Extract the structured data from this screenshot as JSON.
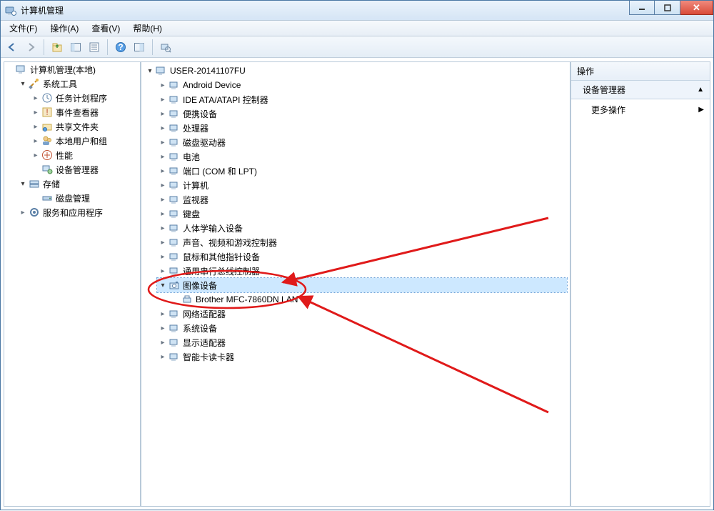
{
  "window": {
    "title": "计算机管理"
  },
  "menu": {
    "file": "文件(F)",
    "action": "操作(A)",
    "view": "查看(V)",
    "help": "帮助(H)"
  },
  "left_tree": {
    "root": "计算机管理(本地)",
    "system_tools": "系统工具",
    "task_scheduler": "任务计划程序",
    "event_viewer": "事件查看器",
    "shared_folders": "共享文件夹",
    "local_users": "本地用户和组",
    "performance": "性能",
    "device_manager": "设备管理器",
    "storage": "存储",
    "disk_mgmt": "磁盘管理",
    "services": "服务和应用程序"
  },
  "mid_tree": {
    "root": "USER-20141107FU",
    "items": [
      "Android Device",
      "IDE ATA/ATAPI 控制器",
      "便携设备",
      "处理器",
      "磁盘驱动器",
      "电池",
      "端口 (COM 和 LPT)",
      "计算机",
      "监视器",
      "键盘",
      "人体学输入设备",
      "声音、视频和游戏控制器",
      "鼠标和其他指针设备",
      "通用串行总线控制器"
    ],
    "imaging": "图像设备",
    "imaging_child": "Brother MFC-7860DN LAN",
    "tail": [
      "网络适配器",
      "系统设备",
      "显示适配器",
      "智能卡读卡器"
    ]
  },
  "right": {
    "header": "操作",
    "sub": "设备管理器",
    "more": "更多操作"
  }
}
